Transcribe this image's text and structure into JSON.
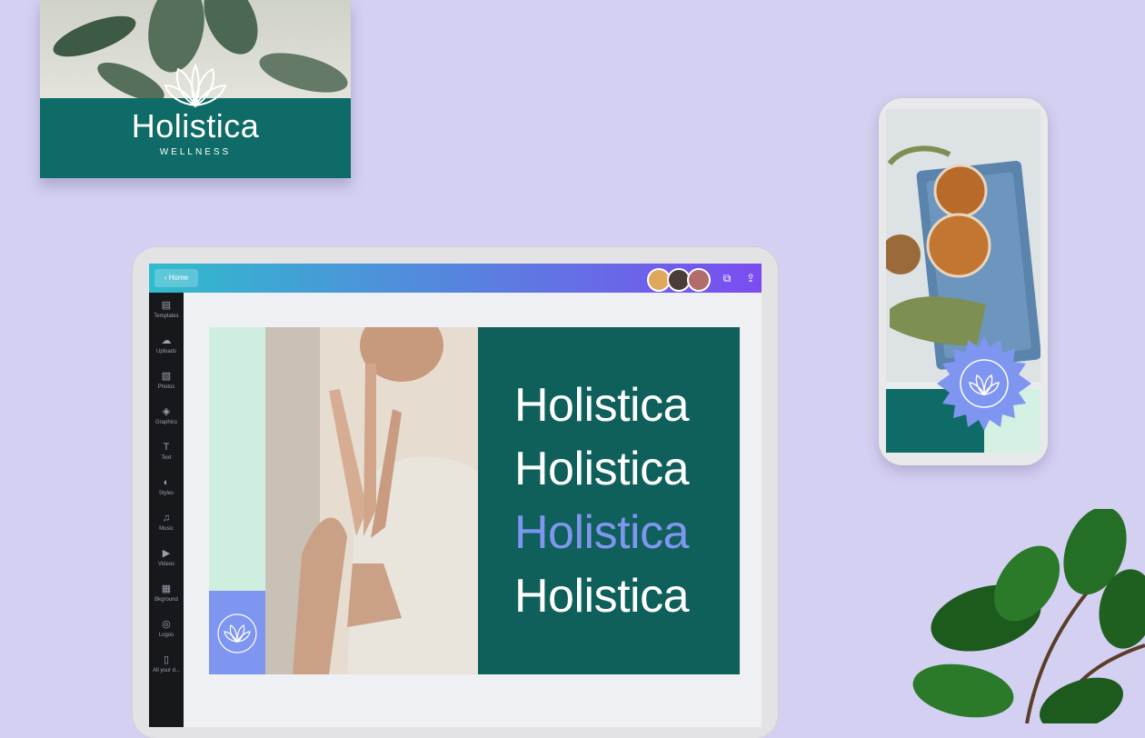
{
  "colors": {
    "background": "#d4d0f1",
    "brand_teal": "#0f6b67",
    "mint": "#cfeee0",
    "lavender": "#7f96f0",
    "highlight_word": "#7f96f0"
  },
  "business_card": {
    "title": "Holistica",
    "subtitle": "WELLNESS"
  },
  "editor": {
    "back_button": "Home",
    "avatars": [
      {
        "name": "collaborator-1",
        "color": "#e0a85a"
      },
      {
        "name": "collaborator-2",
        "color": "#4a3c36"
      },
      {
        "name": "collaborator-3",
        "color": "#b06d6a"
      }
    ],
    "toolbar_icons": [
      "resize-icon",
      "share-icon"
    ],
    "sidebar": [
      {
        "label": "Templates",
        "icon": "▤"
      },
      {
        "label": "Uploads",
        "icon": "☁"
      },
      {
        "label": "Photos",
        "icon": "▧"
      },
      {
        "label": "Graphics",
        "icon": "◈"
      },
      {
        "label": "Text",
        "icon": "T"
      },
      {
        "label": "Styles",
        "icon": "◐"
      },
      {
        "label": "Music",
        "icon": "♫"
      },
      {
        "label": "Videos",
        "icon": "▶"
      },
      {
        "label": "Bkground",
        "icon": "▦"
      },
      {
        "label": "Logos",
        "icon": "◎"
      },
      {
        "label": "All your d...",
        "icon": "▯"
      }
    ],
    "canvas_words": [
      {
        "text": "Holistica",
        "color": "#ffffff",
        "weight": "light"
      },
      {
        "text": "Holistica",
        "color": "#ffffff",
        "weight": "regular"
      },
      {
        "text": "Holistica",
        "color": "#7f96f0",
        "weight": "light"
      },
      {
        "text": "Holistica",
        "color": "#ffffff",
        "weight": "regular"
      }
    ]
  }
}
